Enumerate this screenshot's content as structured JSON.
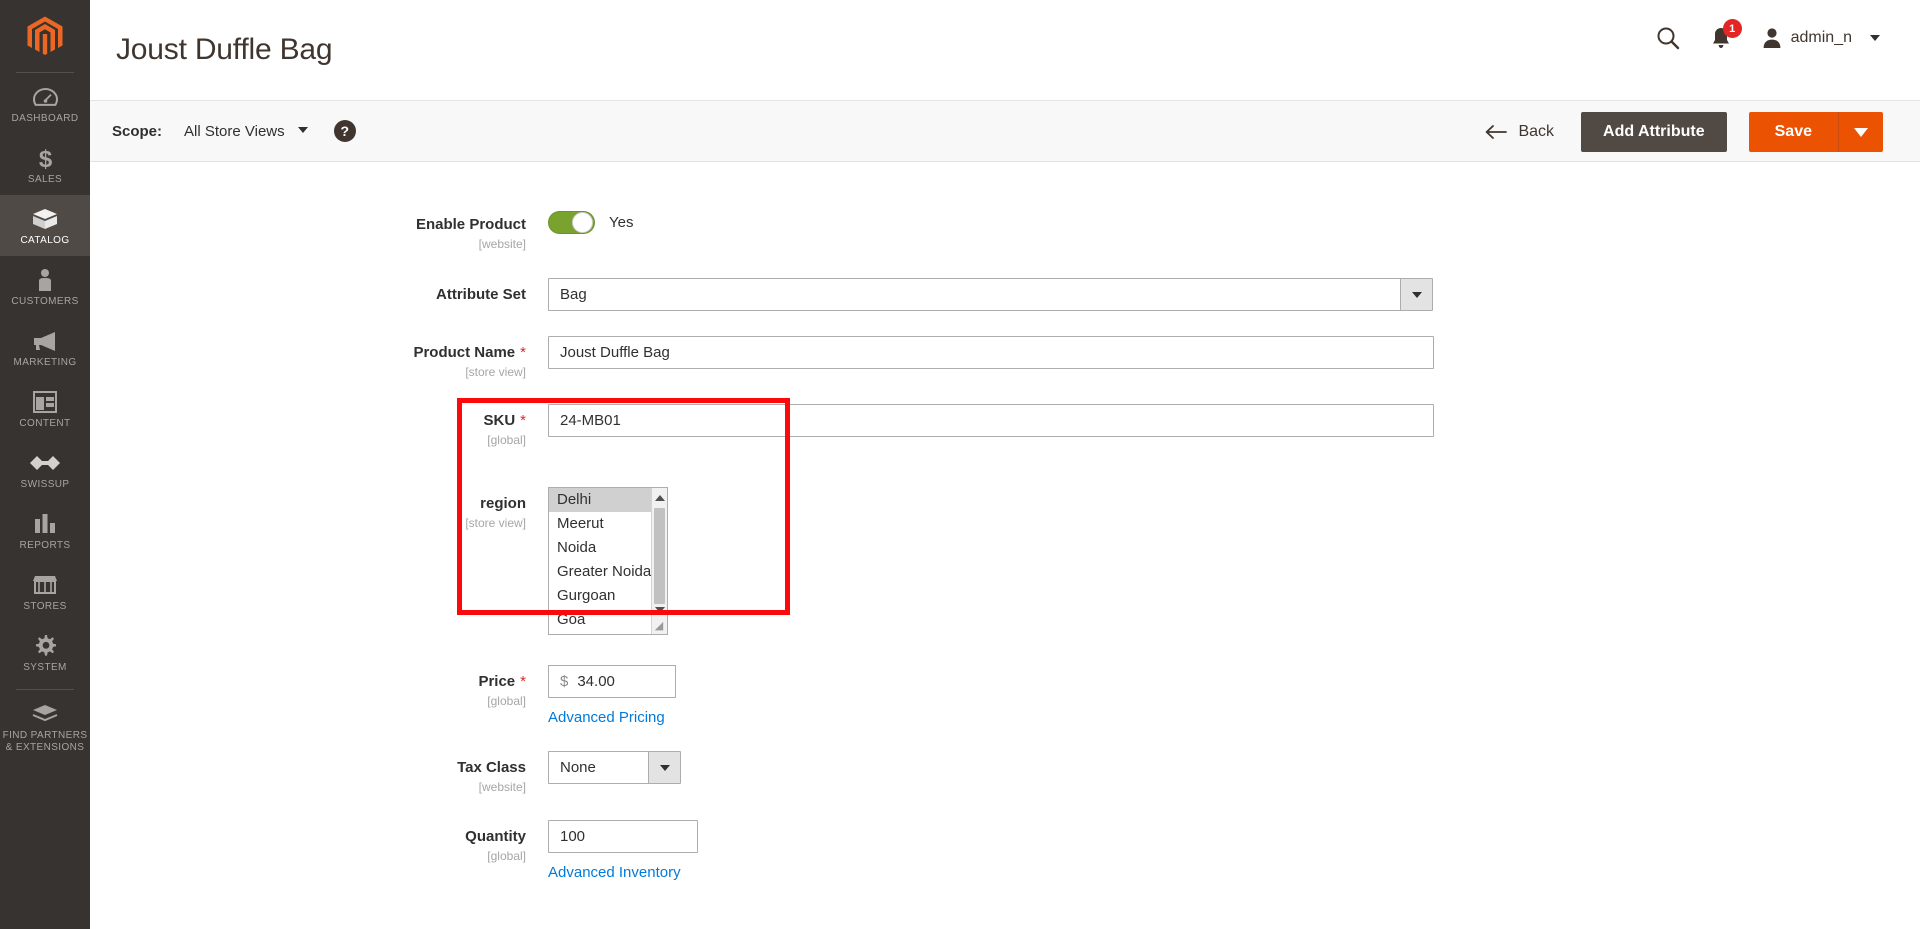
{
  "sidebar": {
    "logo": "magento-logo",
    "items": [
      {
        "label": "DASHBOARD",
        "icon": "dashboard-icon",
        "active": false
      },
      {
        "label": "SALES",
        "icon": "dollar-icon",
        "active": false
      },
      {
        "label": "CATALOG",
        "icon": "box-icon",
        "active": true
      },
      {
        "label": "CUSTOMERS",
        "icon": "person-icon",
        "active": false
      },
      {
        "label": "MARKETING",
        "icon": "megaphone-icon",
        "active": false
      },
      {
        "label": "CONTENT",
        "icon": "layout-icon",
        "active": false
      },
      {
        "label": "SWISSUP",
        "icon": "swissup-icon",
        "active": false
      },
      {
        "label": "REPORTS",
        "icon": "bar-chart-icon",
        "active": false
      },
      {
        "label": "STORES",
        "icon": "store-icon",
        "active": false
      },
      {
        "label": "SYSTEM",
        "icon": "gear-icon",
        "active": false
      },
      {
        "label": "FIND PARTNERS\n& EXTENSIONS",
        "icon": "partners-icon",
        "active": false
      }
    ],
    "find_partners_line1": "FIND PARTNERS",
    "find_partners_line2": "& EXTENSIONS"
  },
  "header": {
    "title": "Joust Duffle Bag",
    "search_icon": "search-icon",
    "notifications_icon": "bell-icon",
    "notifications_count": "1",
    "user_icon": "avatar-icon",
    "user_name": "admin_n"
  },
  "action_bar": {
    "scope_label": "Scope:",
    "scope_value": "All Store Views",
    "help_icon": "question-mark-icon",
    "back_label": "Back",
    "back_icon": "arrow-left-icon",
    "add_attribute_label": "Add Attribute",
    "save_label": "Save",
    "save_dropdown_icon": "chevron-down-icon"
  },
  "form": {
    "enable_product": {
      "label": "Enable Product",
      "scope": "[website]",
      "value": "Yes",
      "toggle_on": true
    },
    "attribute_set": {
      "label": "Attribute Set",
      "scope": "",
      "value": "Bag"
    },
    "product_name": {
      "label": "Product Name",
      "scope": "[store view]",
      "required": true,
      "value": "Joust Duffle Bag"
    },
    "sku": {
      "label": "SKU",
      "scope": "[global]",
      "required": true,
      "value": "24-MB01"
    },
    "region": {
      "label": "region",
      "scope": "[store view]",
      "options": [
        {
          "label": "Delhi",
          "selected": true
        },
        {
          "label": "Meerut",
          "selected": false
        },
        {
          "label": "Noida",
          "selected": false
        },
        {
          "label": "Greater Noida",
          "selected": false
        },
        {
          "label": "Gurgoan",
          "selected": false
        },
        {
          "label": "Goa",
          "selected": false
        }
      ],
      "highlighted": true,
      "highlight_color": "#fa0a0a"
    },
    "price": {
      "label": "Price",
      "scope": "[global]",
      "required": true,
      "currency": "$",
      "value": "34.00",
      "advanced_link": "Advanced Pricing"
    },
    "tax_class": {
      "label": "Tax Class",
      "scope": "[website]",
      "value": "None"
    },
    "quantity": {
      "label": "Quantity",
      "scope": "[global]",
      "value": "100",
      "advanced_link": "Advanced Inventory"
    }
  },
  "colors": {
    "brand_orange": "#eb5202",
    "sidebar_bg": "#373330",
    "toggle_green": "#79a22e",
    "link_blue": "#007bdb",
    "badge_red": "#e22626",
    "highlight_red": "#fa0a0a",
    "dark_button": "#514943"
  }
}
